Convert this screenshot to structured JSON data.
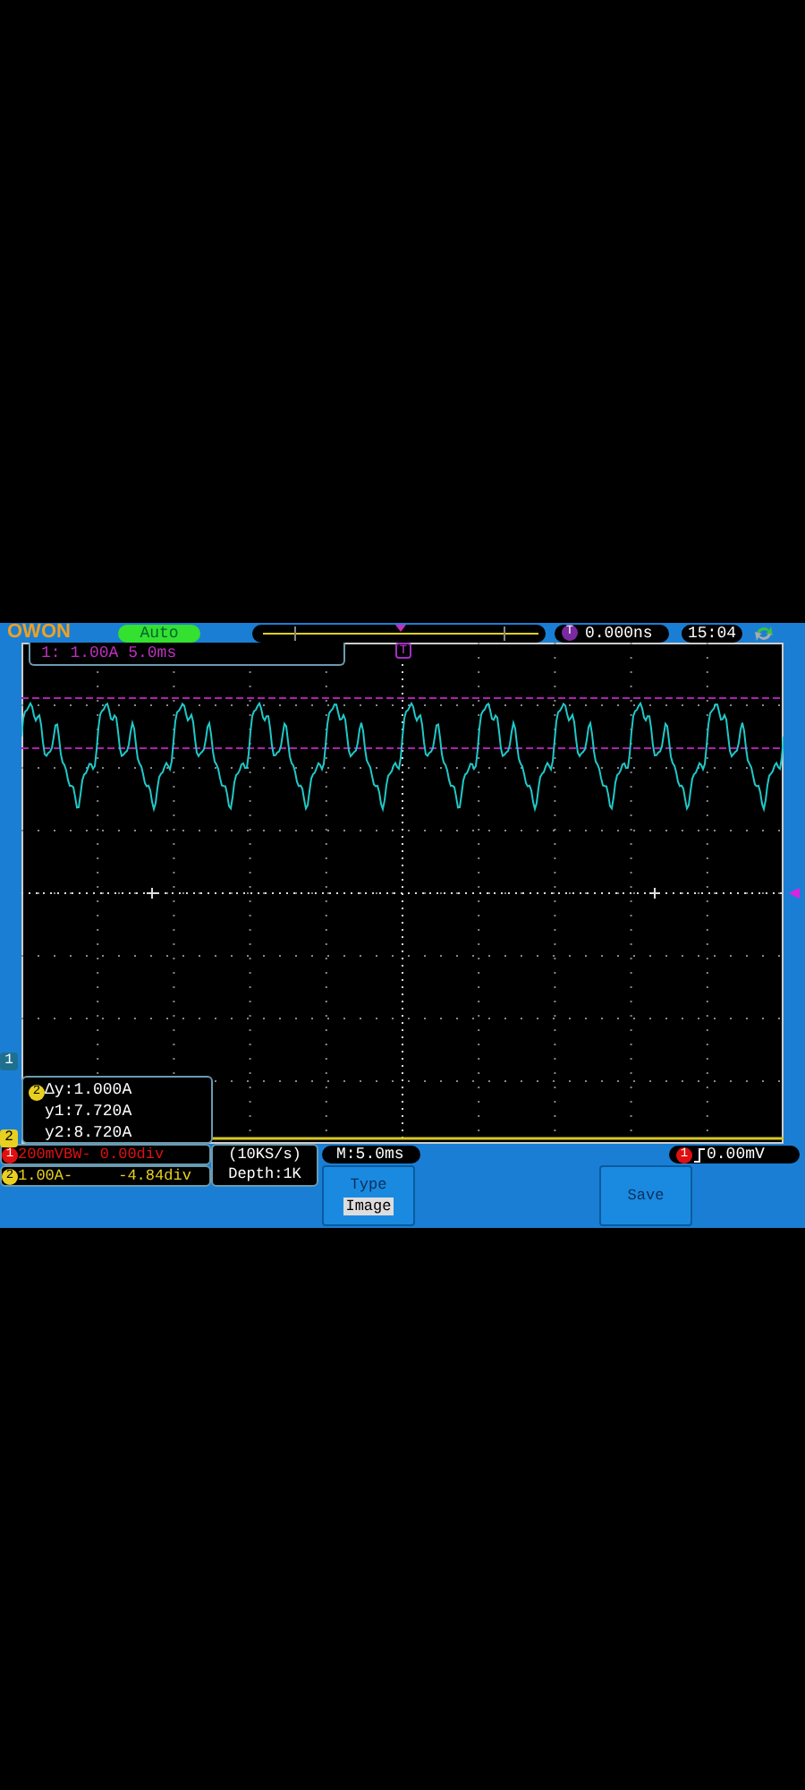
{
  "brand": "OWON",
  "mode": "Auto",
  "trigger_marker": "T",
  "grid_trigger_marker": "T",
  "trigger_time": "0.000ns",
  "clock": "15:04",
  "channel_info": "1: 1.00A 5.0ms",
  "cursor_readout": {
    "badge": "2",
    "lines": [
      "Δy:1.000A",
      "y1:7.720A",
      "y2:8.720A"
    ]
  },
  "channel_markers": [
    {
      "label": "1",
      "color": "#1f6f8f"
    },
    {
      "label": "2",
      "color": "#e8d020"
    }
  ],
  "channels": [
    {
      "badge": "1",
      "text": "200mVBW- 0.00div",
      "color": "#e01010"
    },
    {
      "badge": "2",
      "text": "1.00A-     -4.84div",
      "color": "#e8d020"
    }
  ],
  "sample": {
    "rate": "(10KS/s)",
    "depth": "Depth:1K"
  },
  "timebase": "M:5.0ms",
  "trigger": {
    "badge": "1",
    "level": "0.00mV"
  },
  "buttons": [
    {
      "label": "Type",
      "value": "Image"
    },
    {
      "label": "Save"
    }
  ]
}
